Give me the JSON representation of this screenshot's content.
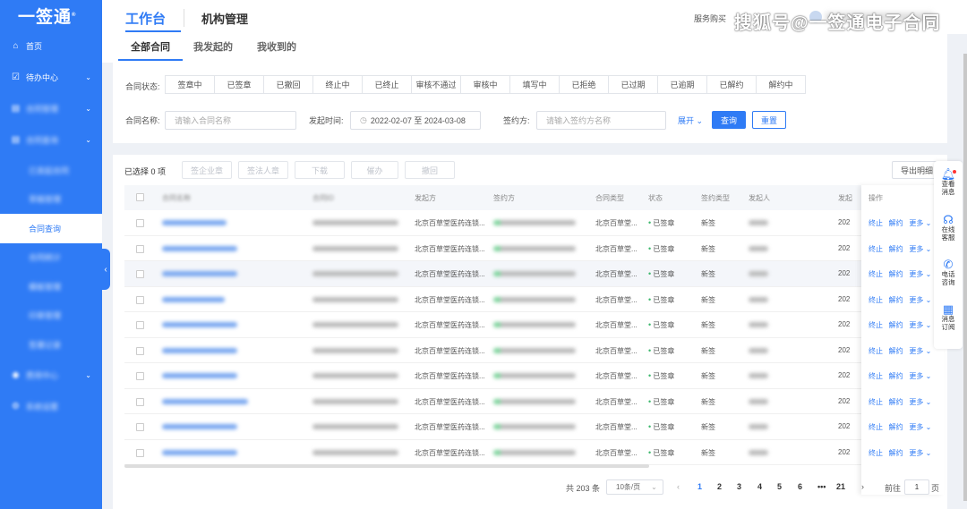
{
  "sidebar": {
    "logo": "一签通",
    "logo_mark": "®",
    "items": [
      {
        "label": "首页",
        "icon": "home-icon",
        "blur": false,
        "chevron": false
      },
      {
        "label": "待办中心",
        "icon": "todo-icon",
        "blur": false,
        "chevron": true
      },
      {
        "label": "合同管理",
        "icon": "folder-icon",
        "blur": true,
        "chevron": true
      },
      {
        "label": "合同查询",
        "icon": "folder-icon",
        "blur": true,
        "chevron": true
      }
    ],
    "subs": [
      {
        "label": "已发起合同",
        "blur": true,
        "active": false
      },
      {
        "label": "草稿管理",
        "blur": true,
        "active": false
      },
      {
        "label": "合同查询",
        "blur": false,
        "active": true
      },
      {
        "label": "合同统计",
        "blur": true,
        "active": false
      },
      {
        "label": "模板管理",
        "blur": true,
        "active": false
      },
      {
        "label": "印章管理",
        "blur": true,
        "active": false
      },
      {
        "label": "签署记录",
        "blur": true,
        "active": false
      }
    ],
    "bottom_items": [
      {
        "label": "费用中心",
        "icon": "money-icon",
        "blur": true,
        "chevron": true
      },
      {
        "label": "系统设置",
        "icon": "settings-icon",
        "blur": true,
        "chevron": false
      }
    ]
  },
  "topbar": {
    "workspace": "工作台",
    "org": "机构管理",
    "service": "服务购买",
    "watermark": "搜狐号@一签通电子合同"
  },
  "tabs": [
    "全部合同",
    "我发起的",
    "我收到的"
  ],
  "filter": {
    "status_label": "合同状态:",
    "statuses": [
      "签章中",
      "已签章",
      "已撤回",
      "终止中",
      "已终止",
      "审核不通过",
      "审核中",
      "填写中",
      "已拒绝",
      "已过期",
      "已逾期",
      "已解约",
      "解约中"
    ],
    "name_label": "合同名称:",
    "name_placeholder": "请输入合同名称",
    "time_label": "发起时间:",
    "time_value": "2022-02-07  至 2024-03-08",
    "signer_label": "签约方:",
    "signer_placeholder": "请输入签约方名称",
    "expand": "展开",
    "search": "查询",
    "reset": "重置"
  },
  "toolbar": {
    "selected": "已选择 0 项",
    "actions": [
      "签企业章",
      "签法人章",
      "下载",
      "催办",
      "撤回"
    ],
    "export": "导出明细"
  },
  "table": {
    "headers": [
      "合同名称",
      "合同ID",
      "发起方",
      "签约方",
      "合同类型",
      "状态",
      "签约类型",
      "发起人",
      "发起"
    ],
    "op_header": "操作",
    "rows": [
      {
        "initiator": "北京百草堂医药连锁...",
        "type": "北京百草堂...",
        "status": "已签章",
        "sign_type": "新签",
        "date": "202",
        "ops": [
          "终止",
          "解约",
          "更多"
        ]
      },
      {
        "initiator": "北京百草堂医药连锁...",
        "type": "北京百草堂...",
        "status": "已签章",
        "sign_type": "新签",
        "date": "202",
        "ops": [
          "终止",
          "解约",
          "更多"
        ]
      },
      {
        "initiator": "北京百草堂医药连锁...",
        "type": "北京百草堂...",
        "status": "已签章",
        "sign_type": "新签",
        "date": "202",
        "ops": [
          "终止",
          "解约",
          "更多"
        ]
      },
      {
        "initiator": "北京百草堂医药连锁...",
        "type": "北京百草堂...",
        "status": "已签章",
        "sign_type": "新签",
        "date": "202",
        "ops": [
          "终止",
          "解约",
          "更多"
        ]
      },
      {
        "initiator": "北京百草堂医药连锁...",
        "type": "北京百草堂...",
        "status": "已签章",
        "sign_type": "新签",
        "date": "202",
        "ops": [
          "终止",
          "解约",
          "更多"
        ]
      },
      {
        "initiator": "北京百草堂医药连锁...",
        "type": "北京百草堂...",
        "status": "已签章",
        "sign_type": "新签",
        "date": "202",
        "ops": [
          "终止",
          "解约",
          "更多"
        ]
      },
      {
        "initiator": "北京百草堂医药连锁...",
        "type": "北京百草堂...",
        "status": "已签章",
        "sign_type": "新签",
        "date": "202",
        "ops": [
          "终止",
          "解约",
          "更多"
        ]
      },
      {
        "initiator": "北京百草堂医药连锁...",
        "type": "北京百草堂...",
        "status": "已签章",
        "sign_type": "新签",
        "date": "202",
        "ops": [
          "终止",
          "解约",
          "更多"
        ]
      },
      {
        "initiator": "北京百草堂医药连锁...",
        "type": "北京百草堂...",
        "status": "已签章",
        "sign_type": "新签",
        "date": "202",
        "ops": [
          "终止",
          "解约",
          "更多"
        ]
      },
      {
        "initiator": "北京百草堂医药连锁...",
        "type": "北京百草堂...",
        "status": "已签章",
        "sign_type": "新签",
        "date": "202",
        "ops": [
          "终止",
          "解约",
          "更多"
        ]
      }
    ]
  },
  "pager": {
    "total": "共 203 条",
    "page_size": "10条/页",
    "pages": [
      "1",
      "2",
      "3",
      "4",
      "5",
      "6",
      "•••",
      "21"
    ],
    "current": "1",
    "goto_label": "前往",
    "goto_value": "1",
    "goto_suffix": "页"
  },
  "float_panel": [
    {
      "label1": "查看",
      "label2": "消息",
      "icon": "bell-icon"
    },
    {
      "label1": "在线",
      "label2": "客服",
      "icon": "headset-icon"
    },
    {
      "label1": "电话",
      "label2": "咨询",
      "icon": "phone-icon"
    },
    {
      "label1": "消息",
      "label2": "订阅",
      "icon": "qrcode-icon"
    }
  ],
  "colors": {
    "primary": "#2f7bf5",
    "success": "#3fb86e"
  }
}
